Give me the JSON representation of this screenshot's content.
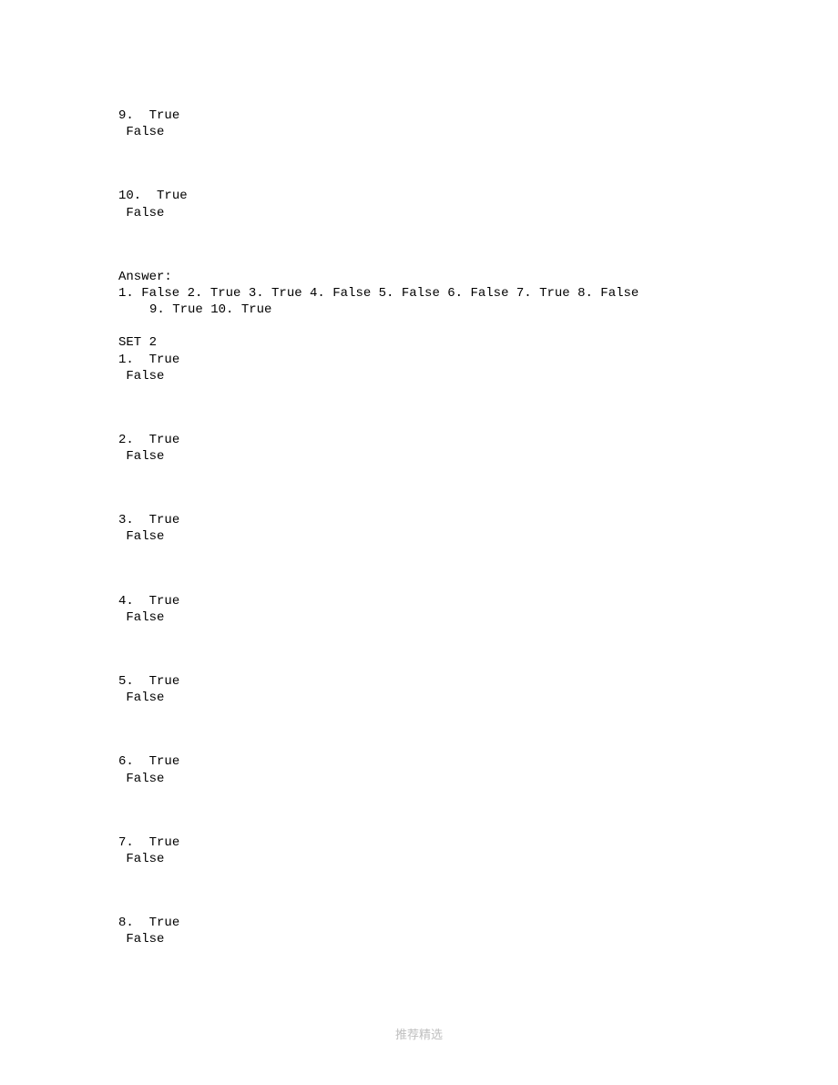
{
  "top_items": [
    {
      "num": "9.",
      "opt1": "True",
      "opt2": "False"
    },
    {
      "num": "10.",
      "opt1": "True",
      "opt2": "False"
    }
  ],
  "answer": {
    "heading": "Answer:",
    "line": "1.  False 2. True 3. True 4. False 5. False 6. False 7. True 8. False 9. True 10. True"
  },
  "set2": {
    "heading": "SET 2",
    "items": [
      {
        "num": "1.",
        "opt1": "True",
        "opt2": "False"
      },
      {
        "num": "2.",
        "opt1": "True",
        "opt2": "False"
      },
      {
        "num": "3.",
        "opt1": "True",
        "opt2": "False"
      },
      {
        "num": "4.",
        "opt1": "True",
        "opt2": "False"
      },
      {
        "num": "5.",
        "opt1": "True",
        "opt2": "False"
      },
      {
        "num": "6.",
        "opt1": "True",
        "opt2": "False"
      },
      {
        "num": "7.",
        "opt1": "True",
        "opt2": "False"
      },
      {
        "num": "8.",
        "opt1": "True",
        "opt2": "False"
      }
    ]
  },
  "footer": "推荐精选"
}
